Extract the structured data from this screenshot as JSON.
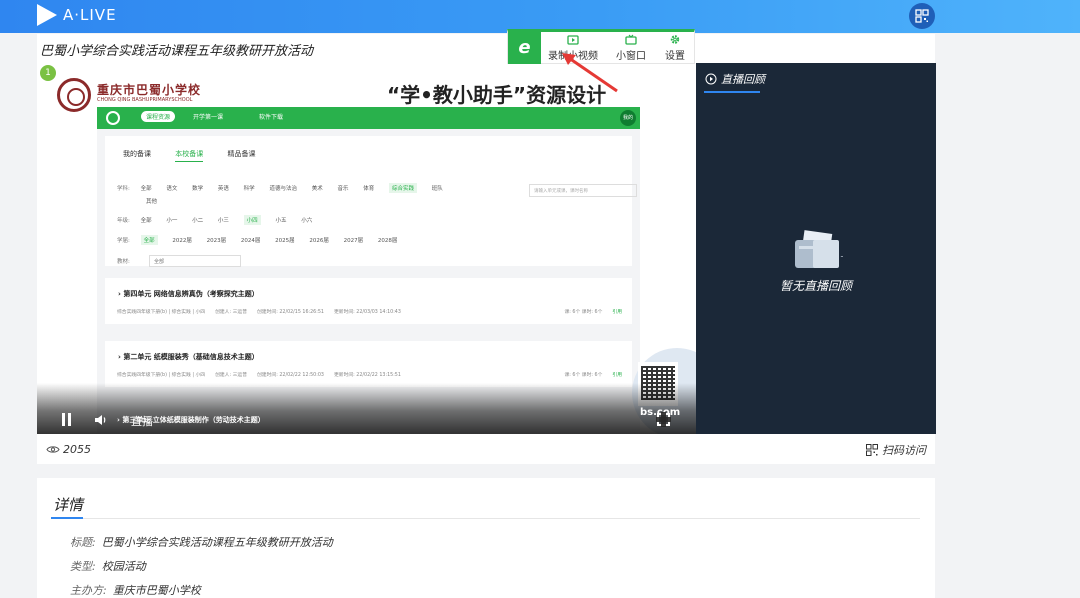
{
  "app": {
    "logo_text": "A·LIVE"
  },
  "page": {
    "title": "巴蜀小学综合实践活动课程五年级教研开放活动"
  },
  "toolbar": {
    "items": [
      {
        "label": "录制小视频",
        "icon": "video-record-icon"
      },
      {
        "label": "小窗口",
        "icon": "tv-icon"
      },
      {
        "label": "设置",
        "icon": "gear-icon"
      }
    ]
  },
  "slide": {
    "badge": "1",
    "school_cn": "重庆市巴蜀小学校",
    "school_en": "CHONG QING BASHUPRIMARYSCHOOL",
    "title": "“学•教小助手”资源设计",
    "nav": {
      "tab1": "课程资源",
      "tab2": "开学第一课",
      "tab3": "软件下载",
      "user": "我的"
    },
    "tabs": [
      "我的备课",
      "本校备课",
      "精品备课"
    ],
    "filters": {
      "subject_label": "学科:",
      "subjects": [
        "全部",
        "语文",
        "数学",
        "英语",
        "科学",
        "道德与法治",
        "美术",
        "音乐",
        "体育",
        "综合实践",
        "班队"
      ],
      "subject_extra": "其他",
      "grade_label": "年级:",
      "grades": [
        "全部",
        "小一",
        "小二",
        "小三",
        "小四",
        "小五",
        "小六"
      ],
      "term_label": "学届:",
      "terms": [
        "全部",
        "2022届",
        "2023届",
        "2024届",
        "2025届",
        "2026届",
        "2027届",
        "2028届"
      ],
      "book_label": "教材:",
      "book_value": "全部",
      "search_placeholder": "请输入单元或课，课时名称"
    },
    "cards": [
      {
        "title": "第四单元 网络信息辨真伪（考察探究主题）",
        "meta1": "综合实践四年级下册(b) | 综合实践 | 小四",
        "creator": "创建人: 三运普",
        "created": "创建时间: 22/02/15 16:26:51",
        "updated": "更新时间: 22/03/03 14:10:43",
        "lessons": "课: 6个",
        "hours": "课时: 6个",
        "action": "引用"
      },
      {
        "title": "第二单元 纸模服装秀（基础信息技术主题）",
        "meta1": "综合实践四年级下册(b) | 综合实践 | 小四",
        "creator": "创建人: 三运普",
        "created": "创建时间: 22/02/22 12:50:03",
        "updated": "更新时间: 22/02/22 13:15:51",
        "lessons": "课: 6个",
        "hours": "课时: 6个",
        "action": "引用"
      }
    ],
    "third_card_title": "第三单元 立体纸模服装制作（劳动技术主题）",
    "site_text": "bs.com"
  },
  "player": {
    "live_label": "直播"
  },
  "replay": {
    "tab_label": "直播回顾",
    "empty_text": "暂无直播回顾"
  },
  "stats": {
    "views": "2055",
    "scan_label": "扫码访问"
  },
  "details": {
    "heading": "详情",
    "rows": [
      {
        "key": "标题:",
        "value": "巴蜀小学综合实践活动课程五年级教研开放活动"
      },
      {
        "key": "类型:",
        "value": "校园活动"
      },
      {
        "key": "主办方:",
        "value": "重庆市巴蜀小学校"
      }
    ]
  },
  "colors": {
    "brand_blue": "#2f86f0",
    "accent_green": "#29b14c",
    "replay_bg": "#1b2838",
    "arrow_red": "#e53935"
  }
}
